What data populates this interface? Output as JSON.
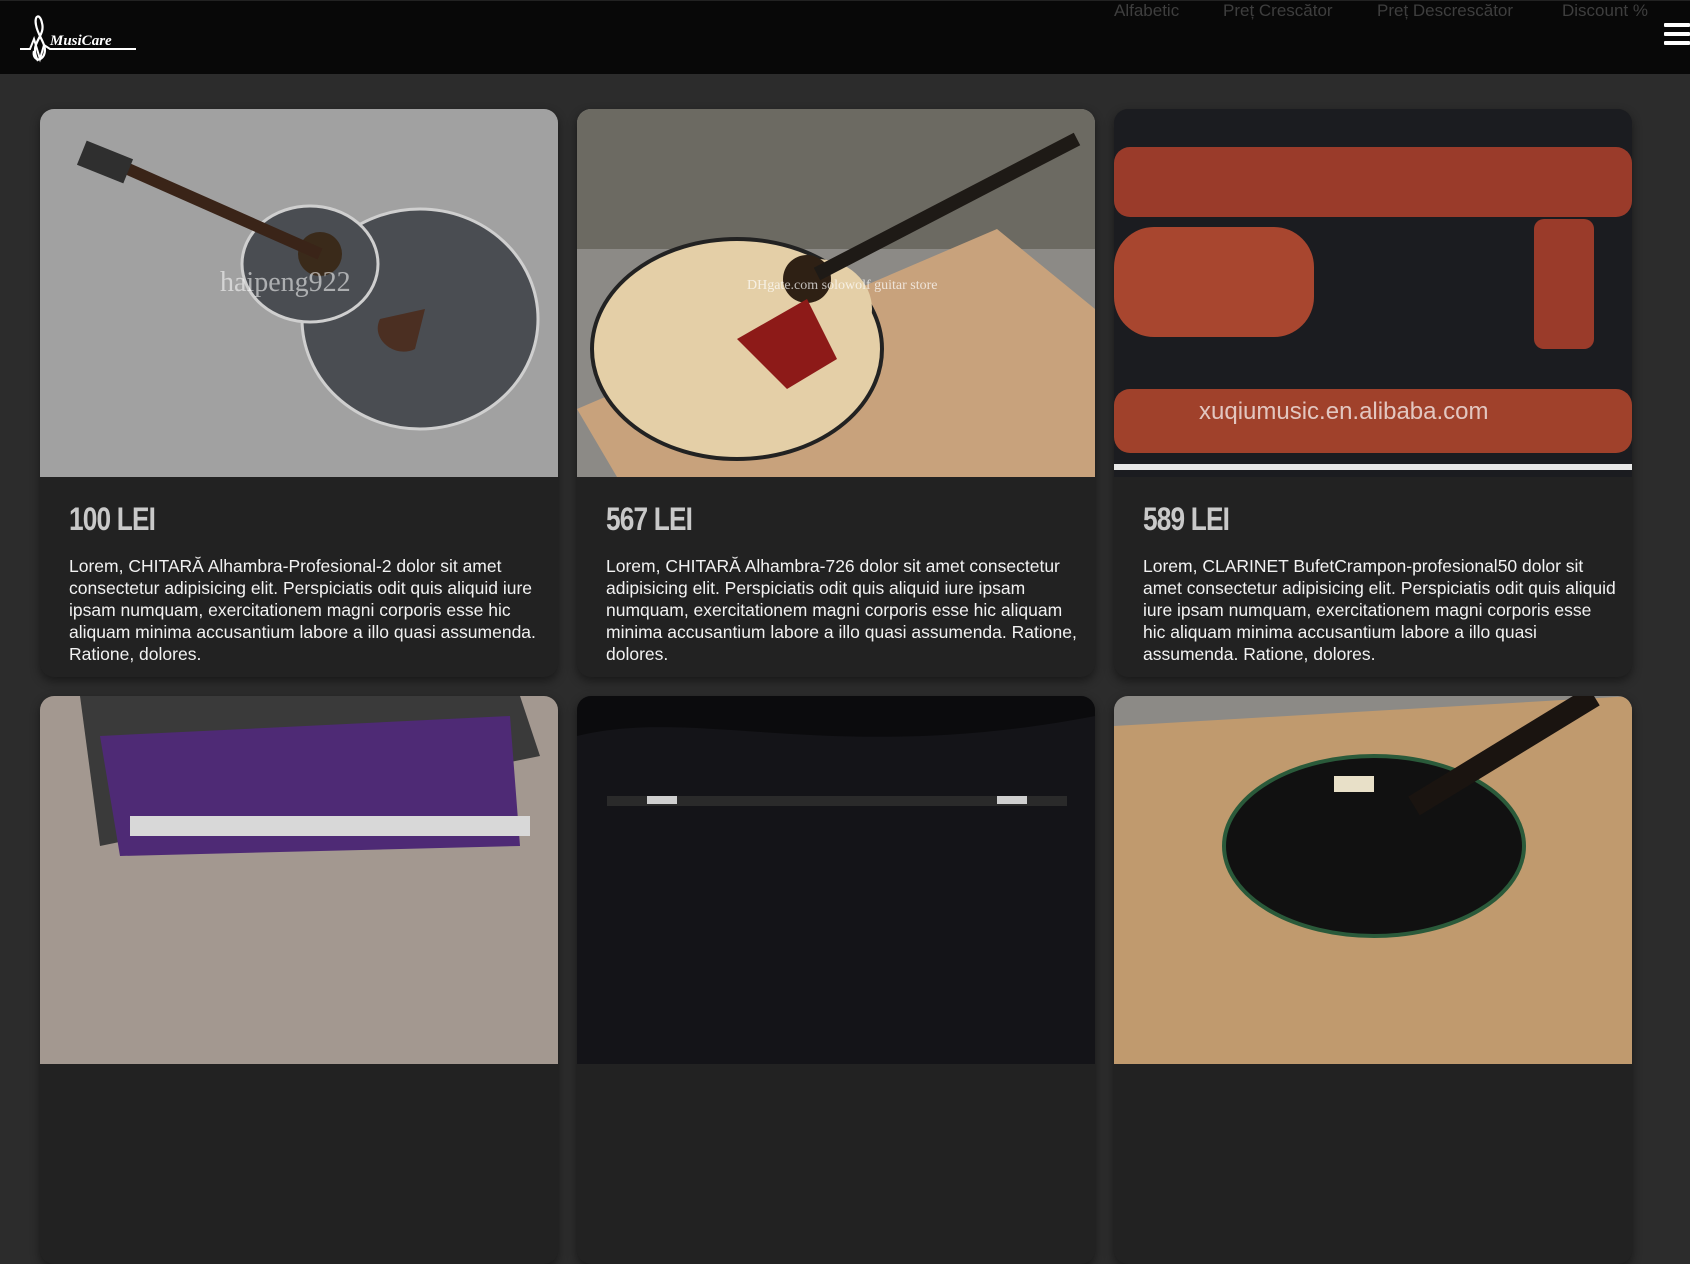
{
  "header": {
    "logo_text": "MusiCare",
    "sort_options": [
      "Alfabetic",
      "Preț Crescător",
      "Preț Descrescător",
      "Discount %"
    ]
  },
  "products": [
    {
      "price": "100 LEI",
      "description": "Lorem, CHITARĂ Alhambra-Profesional-2 dolor sit amet consectetur adipisicing elit. Perspiciatis odit quis aliquid iure ipsam numquam, exercitationem magni corporis esse hic aliquam minima accusantium labore a illo quasi assumenda. Ratione, dolores.",
      "image_watermark": "haipeng922"
    },
    {
      "price": "567 LEI",
      "description": "Lorem, CHITARĂ Alhambra-726 dolor sit amet consectetur adipisicing elit. Perspiciatis odit quis aliquid iure ipsam numquam, exercitationem magni corporis esse hic aliquam minima accusantium labore a illo quasi assumenda. Ratione, dolores.",
      "image_watermark": "DHgate.com solowolf guitar store"
    },
    {
      "price": "589 LEI",
      "description": "Lorem, CLARINET BufetCrampon-profesional50 dolor sit amet consectetur adipisicing elit. Perspiciatis odit quis aliquid iure ipsam numquam, exercitationem magni corporis esse hic aliquam minima accusantium labore a illo quasi assumenda. Ratione, dolores.",
      "image_watermark": "xuqiumusic.en.alibaba.com"
    }
  ],
  "colors": {
    "page_bg": "#2c2c2c",
    "header_bg": "#080808",
    "card_bg": "#222222",
    "price": "#c9c9c9",
    "sort_text": "#3e3e3e"
  }
}
